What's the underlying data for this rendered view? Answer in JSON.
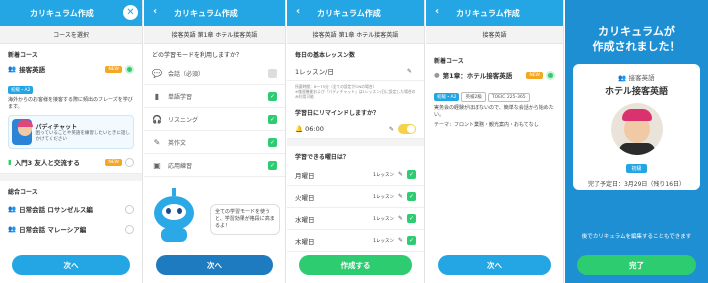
{
  "colors": {
    "primary": "#25a6e4",
    "green": "#2ecc71",
    "navy": "#1e7bc0",
    "new_badge": "#f5a623"
  },
  "s1": {
    "title": "カリキュラム作成",
    "subheader": "コースを選択",
    "section_new": "新着コース",
    "course1": {
      "title": "接客英語",
      "tag": "初級・A2",
      "new": "NEW",
      "desc": "海外からのお客様を接客する際に頻出のフレーズを学びます。",
      "coach_name": "パディチャット",
      "coach_text": "困っていることや英語を練習したいときに話しかけてください"
    },
    "course2": {
      "title": "入門3 友人と交流する",
      "new": "NEW"
    },
    "section_total": "総合コース",
    "course3": {
      "title": "日常会話 ロサンゼルス編"
    },
    "course4": {
      "title": "日常会話 マレーシア編"
    },
    "next": "次へ"
  },
  "s2": {
    "title": "カリキュラム作成",
    "subheader": "接客英語 第1章 ホテル接客英語",
    "question": "どの学習モードを利用しますか？",
    "modes": [
      {
        "label": "会話（必須）",
        "icon": "chat-icon",
        "checked": false
      },
      {
        "label": "単語学習",
        "icon": "book-icon",
        "checked": true
      },
      {
        "label": "リスニング",
        "icon": "headphones-icon",
        "checked": true
      },
      {
        "label": "英作文",
        "icon": "pencil-icon",
        "checked": true
      },
      {
        "label": "応用練習",
        "icon": "image-icon",
        "checked": true
      }
    ],
    "mascot_text": "全ての学習モードを使うと、学習効果が格段に高まるよ！",
    "next": "次へ"
  },
  "s3": {
    "title": "カリキュラム作成",
    "subheader": "接客英語 第1章 ホテル接客英語",
    "daily_label": "毎日の基本レッスン数",
    "daily_value": "1レッスン/日",
    "note": "所要時間：8～75分（全ての設定がONの場合）\n※復習機能および「パディチャット」は1レッスン/日に設定した場合のみ利用可能",
    "remind_label": "学習日にリマインドしますか？",
    "remind_time": "06:00",
    "days_label": "学習できる曜日は？",
    "days": [
      {
        "label": "月曜日",
        "count": "1レッスン"
      },
      {
        "label": "火曜日",
        "count": "1レッスン"
      },
      {
        "label": "水曜日",
        "count": "1レッスン"
      },
      {
        "label": "木曜日",
        "count": "1レッスン"
      }
    ],
    "create": "作成する"
  },
  "s4": {
    "title": "カリキュラム作成",
    "subheader": "接客英語",
    "section": "新着コース",
    "chapter_title": "第1章：ホテル接客英語",
    "tags": [
      "初級・A2",
      "英検2級",
      "TOEIC 225-365"
    ],
    "new": "NEW",
    "desc": "実务会の経験がほぼないので、簡単な会話から始めたい。",
    "theme": "テーマ：フロント業務・観光案内・おもてなし",
    "next": "次へ"
  },
  "s5": {
    "heading": "カリキュラムが\n作成されました！",
    "course_label": "接客英語",
    "course_title": "ホテル接客英語",
    "level": "初級",
    "end_date": "完了予定日：3月29日（残り16日）",
    "edit_note": "後でカリキュラムを編集することもできます",
    "done": "完了"
  }
}
